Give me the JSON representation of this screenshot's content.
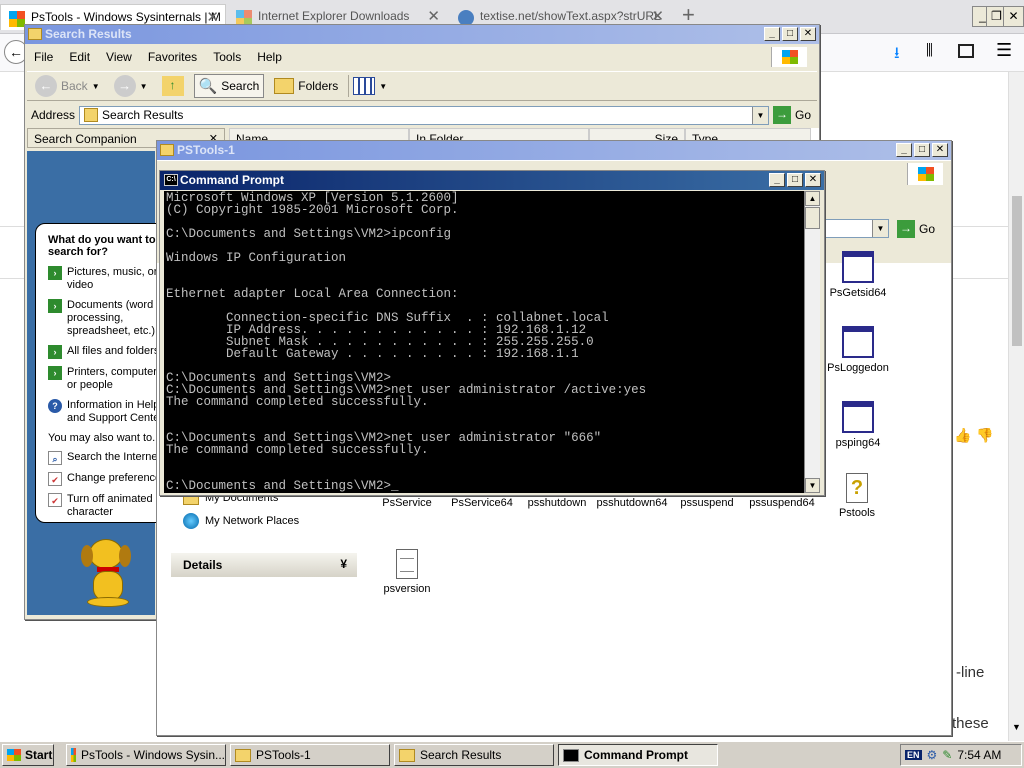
{
  "firefox": {
    "tabs": [
      {
        "title": "PsTools - Windows Sysinternals | M"
      },
      {
        "title": "Internet Explorer Downloads"
      },
      {
        "title": "textise.net/showText.aspx?strURL"
      }
    ],
    "new_tab": "+",
    "page_text_1": "-line",
    "page_text_2": "these"
  },
  "search_results": {
    "title": "Search Results",
    "menu": [
      "File",
      "Edit",
      "View",
      "Favorites",
      "Tools",
      "Help"
    ],
    "toolbar": {
      "back": "Back",
      "search": "Search",
      "folders": "Folders"
    },
    "address_label": "Address",
    "address_value": "Search Results",
    "go": "Go",
    "companion_title": "Search Companion",
    "columns": [
      "Name",
      "In Folder",
      "Size",
      "Type"
    ],
    "bubble": {
      "question": "What do you want to search for?",
      "items": [
        "Pictures, music, or video",
        "Documents (word processing, spreadsheet, etc.)",
        "All files and folders",
        "Printers, computers, or people",
        "Information in Help and Support Center"
      ],
      "also_label": "You may also want to...",
      "also_items": [
        "Search the Internet",
        "Change preferences",
        "Turn off animated character"
      ]
    }
  },
  "pstools": {
    "title": "PSTools-1",
    "go": "Go",
    "places": [
      "My Documents",
      "My Network Places"
    ],
    "details_label": "Details",
    "files": [
      {
        "name": "PsGetsid64"
      },
      {
        "name": "PsLoggedon"
      },
      {
        "name": "psping64"
      },
      {
        "name": "PsService"
      },
      {
        "name": "PsService64"
      },
      {
        "name": "psshutdown"
      },
      {
        "name": "psshutdown64"
      },
      {
        "name": "pssuspend"
      },
      {
        "name": "pssuspend64"
      },
      {
        "name": "Pstools"
      },
      {
        "name": "psversion"
      }
    ]
  },
  "cmd": {
    "title": "Command Prompt",
    "lines": [
      "Microsoft Windows XP [Version 5.1.2600]",
      "(C) Copyright 1985-2001 Microsoft Corp.",
      "",
      "C:\\Documents and Settings\\VM2>ipconfig",
      "",
      "Windows IP Configuration",
      "",
      "",
      "Ethernet adapter Local Area Connection:",
      "",
      "        Connection-specific DNS Suffix  . : collabnet.local",
      "        IP Address. . . . . . . . . . . . : 192.168.1.12",
      "        Subnet Mask . . . . . . . . . . . : 255.255.255.0",
      "        Default Gateway . . . . . . . . . : 192.168.1.1",
      "",
      "C:\\Documents and Settings\\VM2>",
      "C:\\Documents and Settings\\VM2>net user administrator /active:yes",
      "The command completed successfully.",
      "",
      "",
      "C:\\Documents and Settings\\VM2>net user administrator \"666\"",
      "The command completed successfully.",
      "",
      "",
      "C:\\Documents and Settings\\VM2>_"
    ]
  },
  "taskbar": {
    "start": "Start",
    "items": [
      "PsTools - Windows Sysin...",
      "PSTools-1",
      "Search Results",
      "Command Prompt"
    ],
    "lang": "EN",
    "clock": "7:54 AM"
  }
}
